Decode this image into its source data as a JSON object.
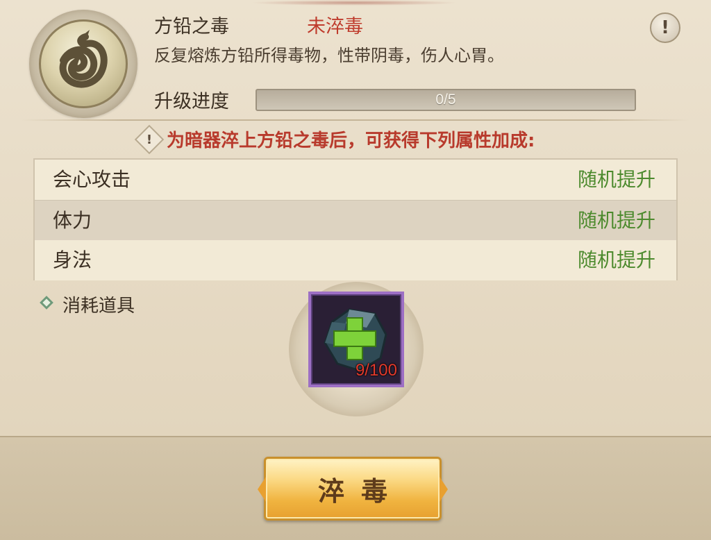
{
  "poison": {
    "name": "方铅之毒",
    "status": "未淬毒",
    "status_color": "#bf3b2c",
    "description": "反复熔炼方铅所得毒物，性带阴毒，伤人心胃。",
    "icon": "poison-swirl-emblem"
  },
  "progress": {
    "label": "升级进度",
    "text": "0/5",
    "current": 0,
    "max": 5
  },
  "notice": {
    "icon": "exclamation-diamond-icon",
    "text": "为暗器淬上方铅之毒后，可获得下列属性加成:"
  },
  "attributes": [
    {
      "name": "会心攻击",
      "value": "随机提升"
    },
    {
      "name": "体力",
      "value": "随机提升"
    },
    {
      "name": "身法",
      "value": "随机提升"
    }
  ],
  "consume": {
    "label": "消耗道具",
    "icon": "diamond-bullet-icon",
    "item_icon": "ore-plus-icon",
    "count_text": "9/100"
  },
  "action": {
    "label": "淬毒"
  },
  "info_button": {
    "icon": "exclamation-icon",
    "glyph": "!"
  },
  "colors": {
    "accent_green": "#4c8a2d",
    "warning_red": "#b83a2c",
    "slot_border": "#9d6fc4",
    "button_gold": "#f0b440"
  }
}
